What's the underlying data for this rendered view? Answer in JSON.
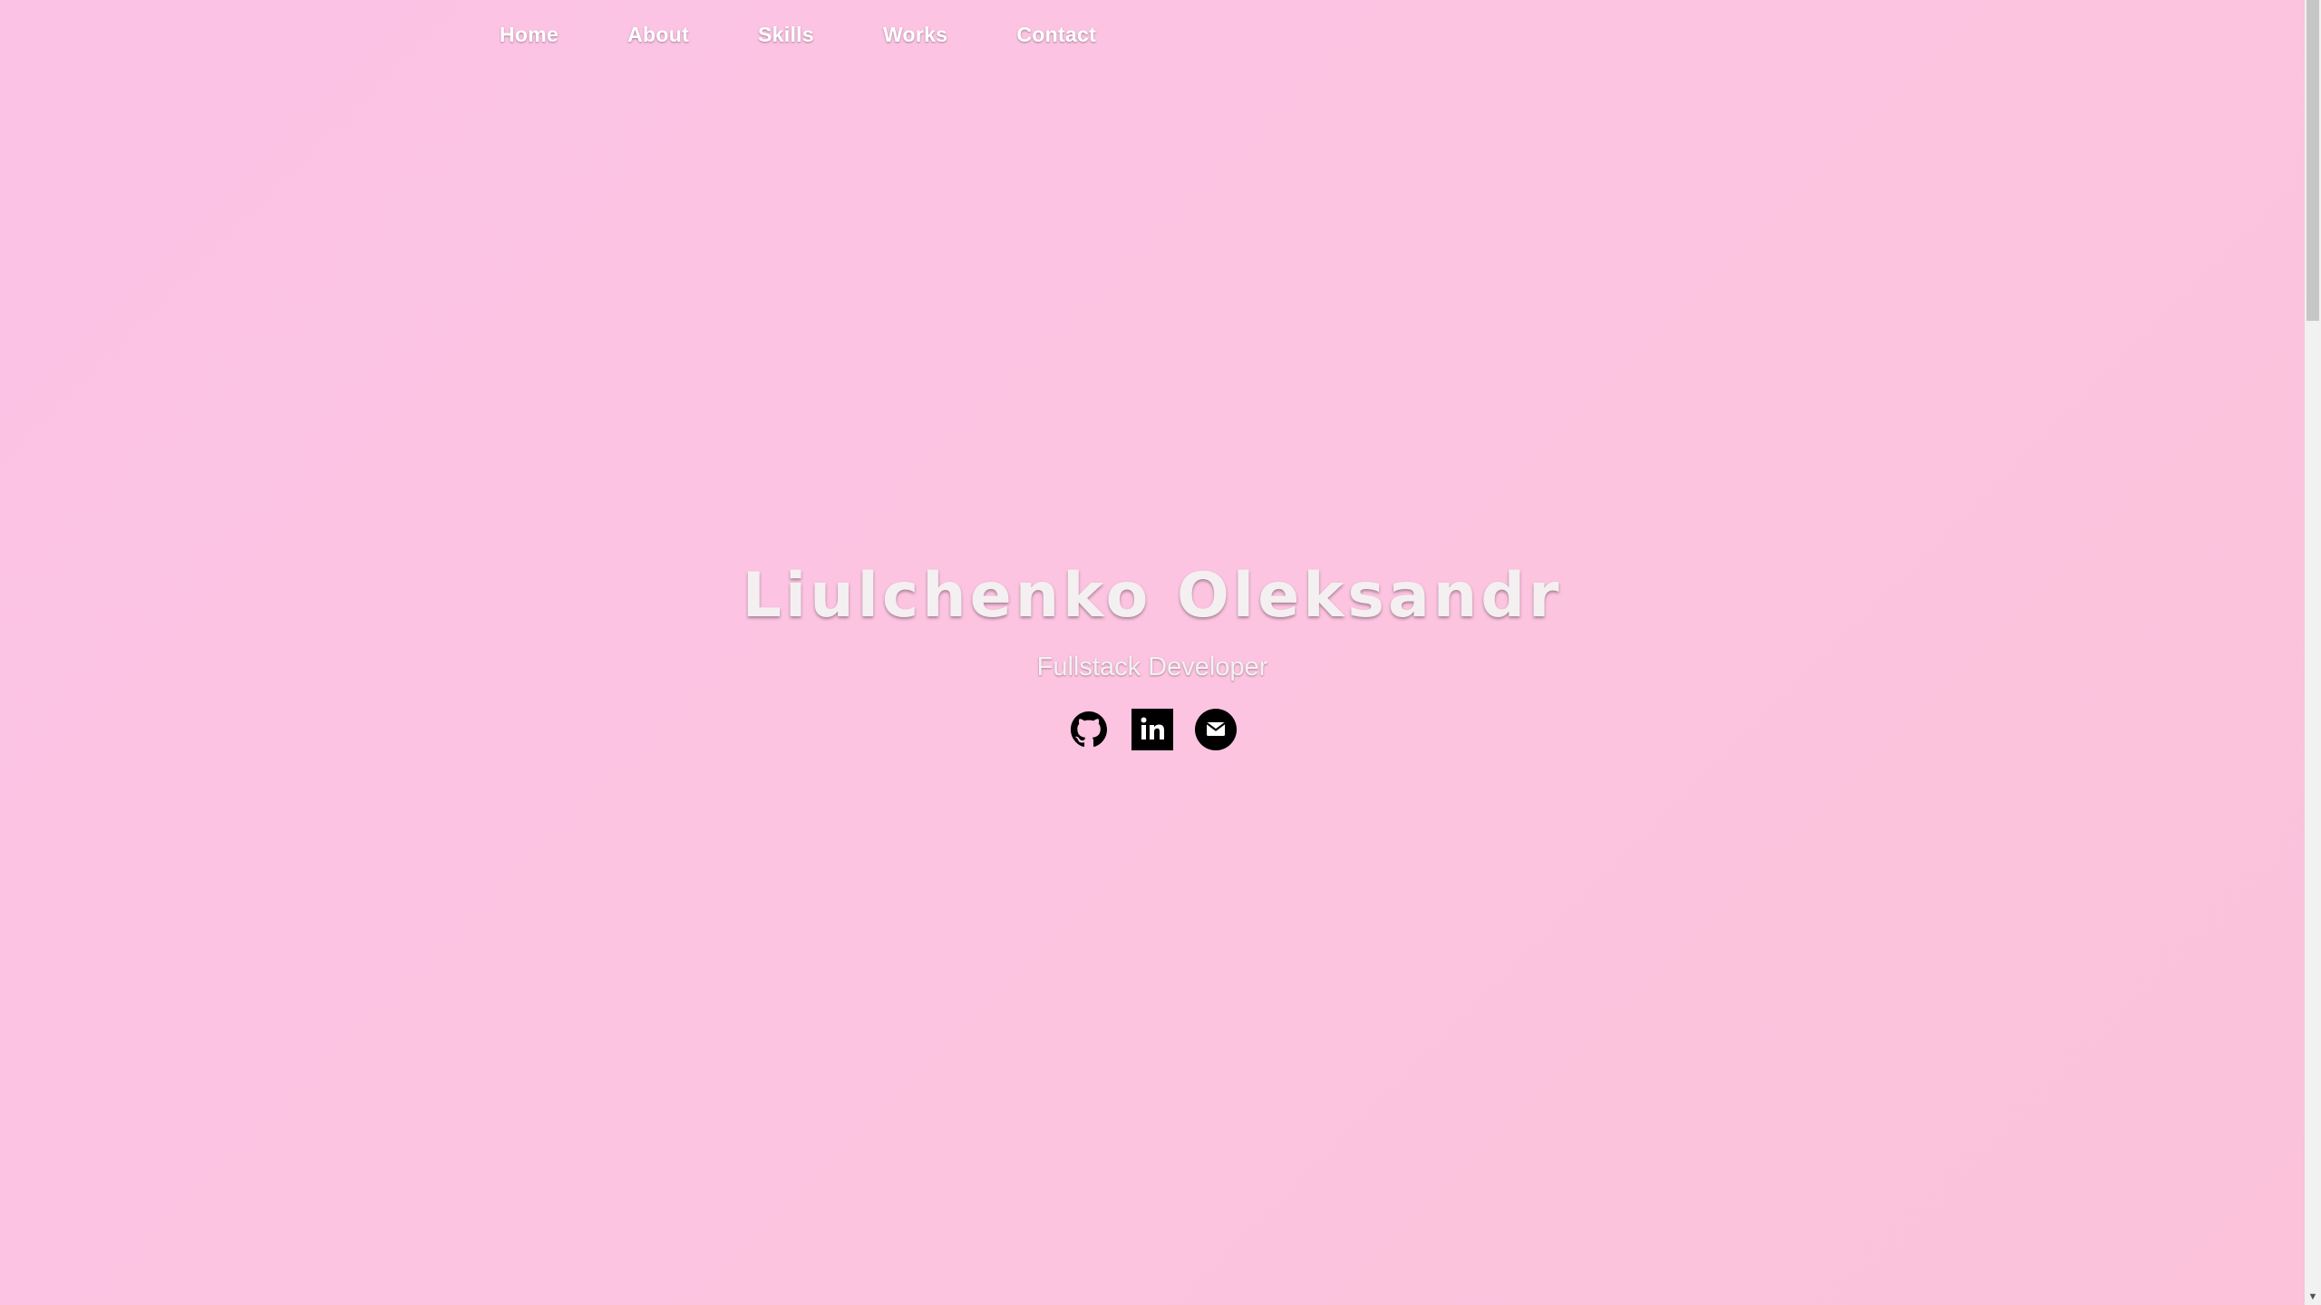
{
  "nav": {
    "items": [
      {
        "label": "Home"
      },
      {
        "label": "About"
      },
      {
        "label": "Skills"
      },
      {
        "label": "Works"
      },
      {
        "label": "Contact"
      }
    ]
  },
  "hero": {
    "name": "Liulchenko Oleksandr",
    "role": "Fullstack Developer"
  },
  "socials": {
    "icons": [
      "github-icon",
      "linkedin-icon",
      "mail-icon"
    ]
  },
  "colors": {
    "background": "#fbc2e6",
    "text": "#f4f0f2",
    "icon": "#000000"
  }
}
